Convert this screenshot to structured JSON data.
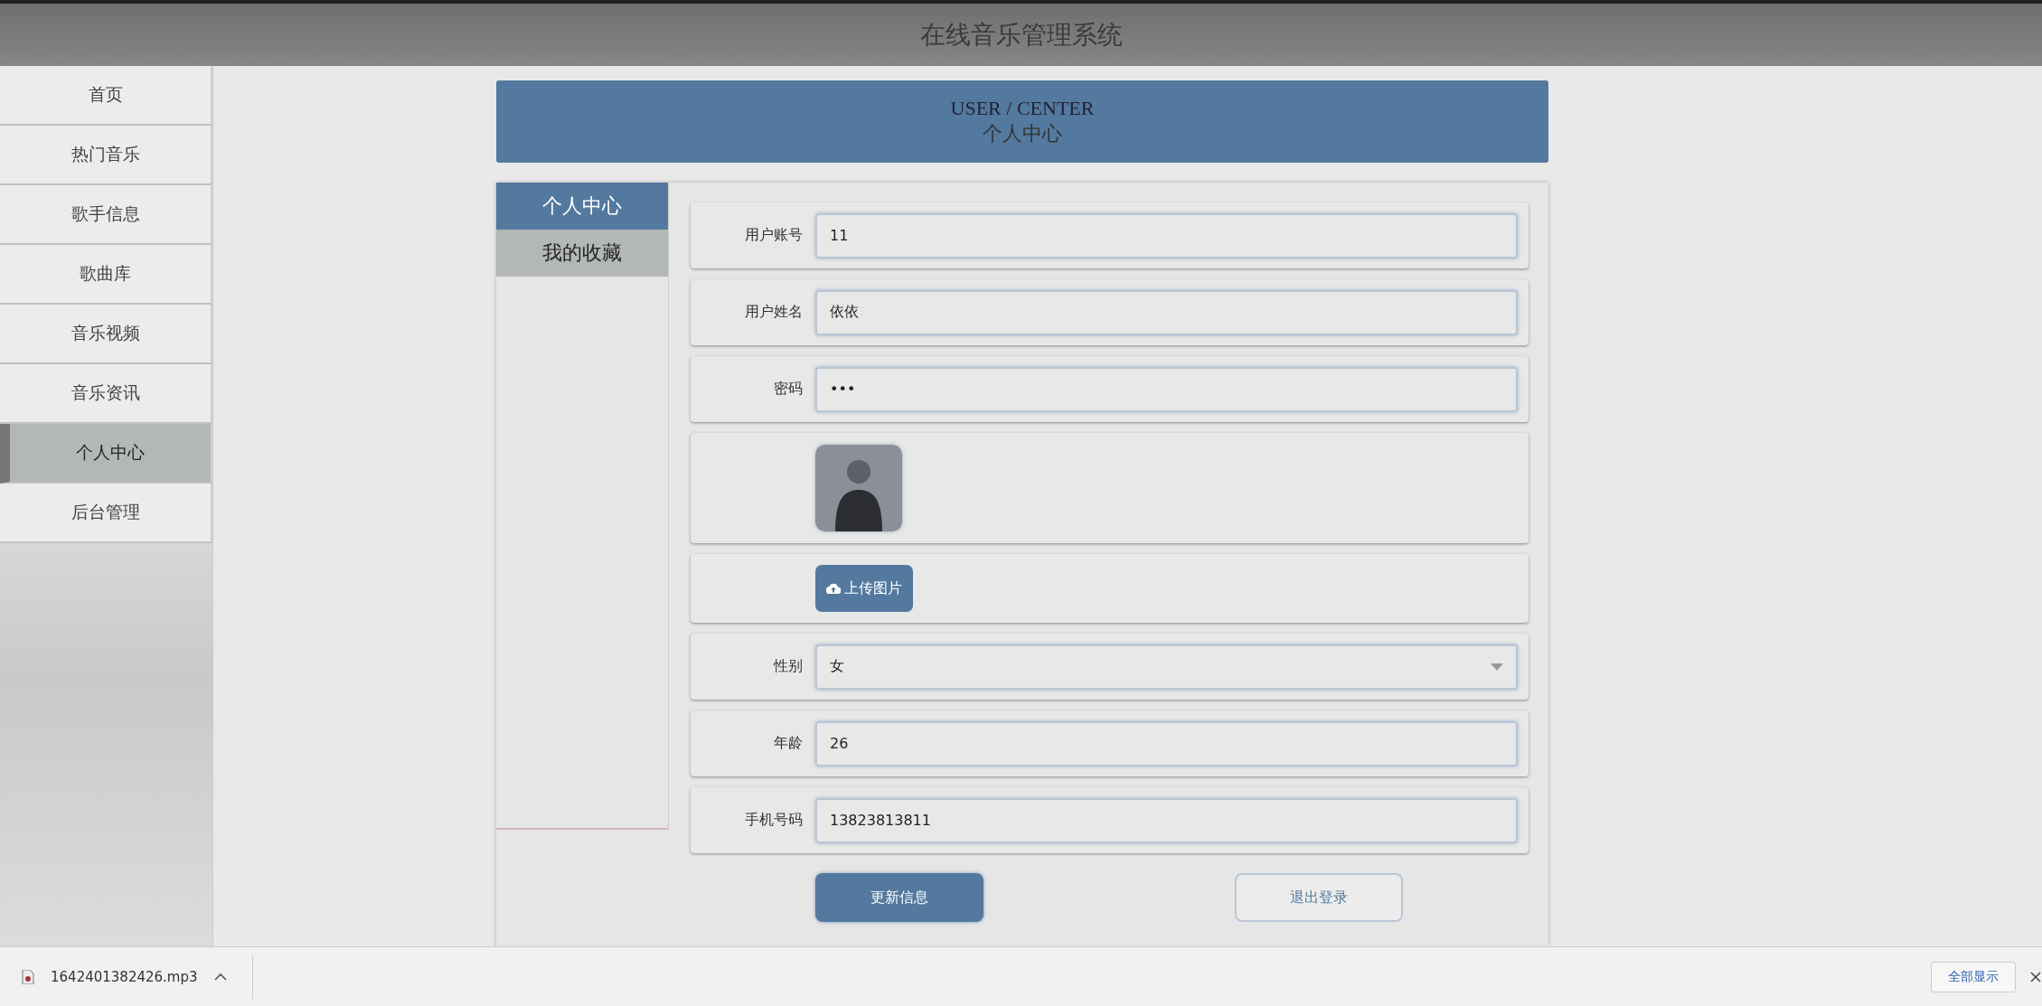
{
  "window": {
    "title": "在线音乐管理系统"
  },
  "sidebar": {
    "items": [
      {
        "label": "首页",
        "selected": false
      },
      {
        "label": "热门音乐",
        "selected": false
      },
      {
        "label": "歌手信息",
        "selected": false
      },
      {
        "label": "歌曲库",
        "selected": false
      },
      {
        "label": "音乐视频",
        "selected": false
      },
      {
        "label": "音乐资讯",
        "selected": false
      },
      {
        "label": "个人中心",
        "selected": true
      },
      {
        "label": "后台管理",
        "selected": false
      }
    ]
  },
  "banner": {
    "title": "USER / CENTER",
    "subtitle": "个人中心"
  },
  "tabs": [
    {
      "label": "个人中心",
      "selected": true
    },
    {
      "label": "我的收藏",
      "selected": false
    }
  ],
  "form": {
    "fields": [
      {
        "kind": "text",
        "label": "用户账号",
        "value": "11"
      },
      {
        "kind": "text",
        "label": "用户姓名",
        "value": "依依"
      },
      {
        "kind": "text",
        "label": "密码",
        "value": "•••"
      },
      {
        "kind": "image"
      },
      {
        "kind": "upload",
        "button": "上传图片"
      },
      {
        "kind": "select",
        "label": "性别",
        "value": "女"
      },
      {
        "kind": "text",
        "label": "年龄",
        "value": "26"
      },
      {
        "kind": "text",
        "label": "手机号码",
        "value": "13823813811"
      }
    ],
    "buttons": [
      {
        "kind": "primary",
        "label": "更新信息"
      },
      {
        "kind": "outline",
        "label": "退出登录"
      }
    ]
  },
  "download_bar": {
    "file": "1642401382426.mp3",
    "show_all": "全部显示"
  }
}
